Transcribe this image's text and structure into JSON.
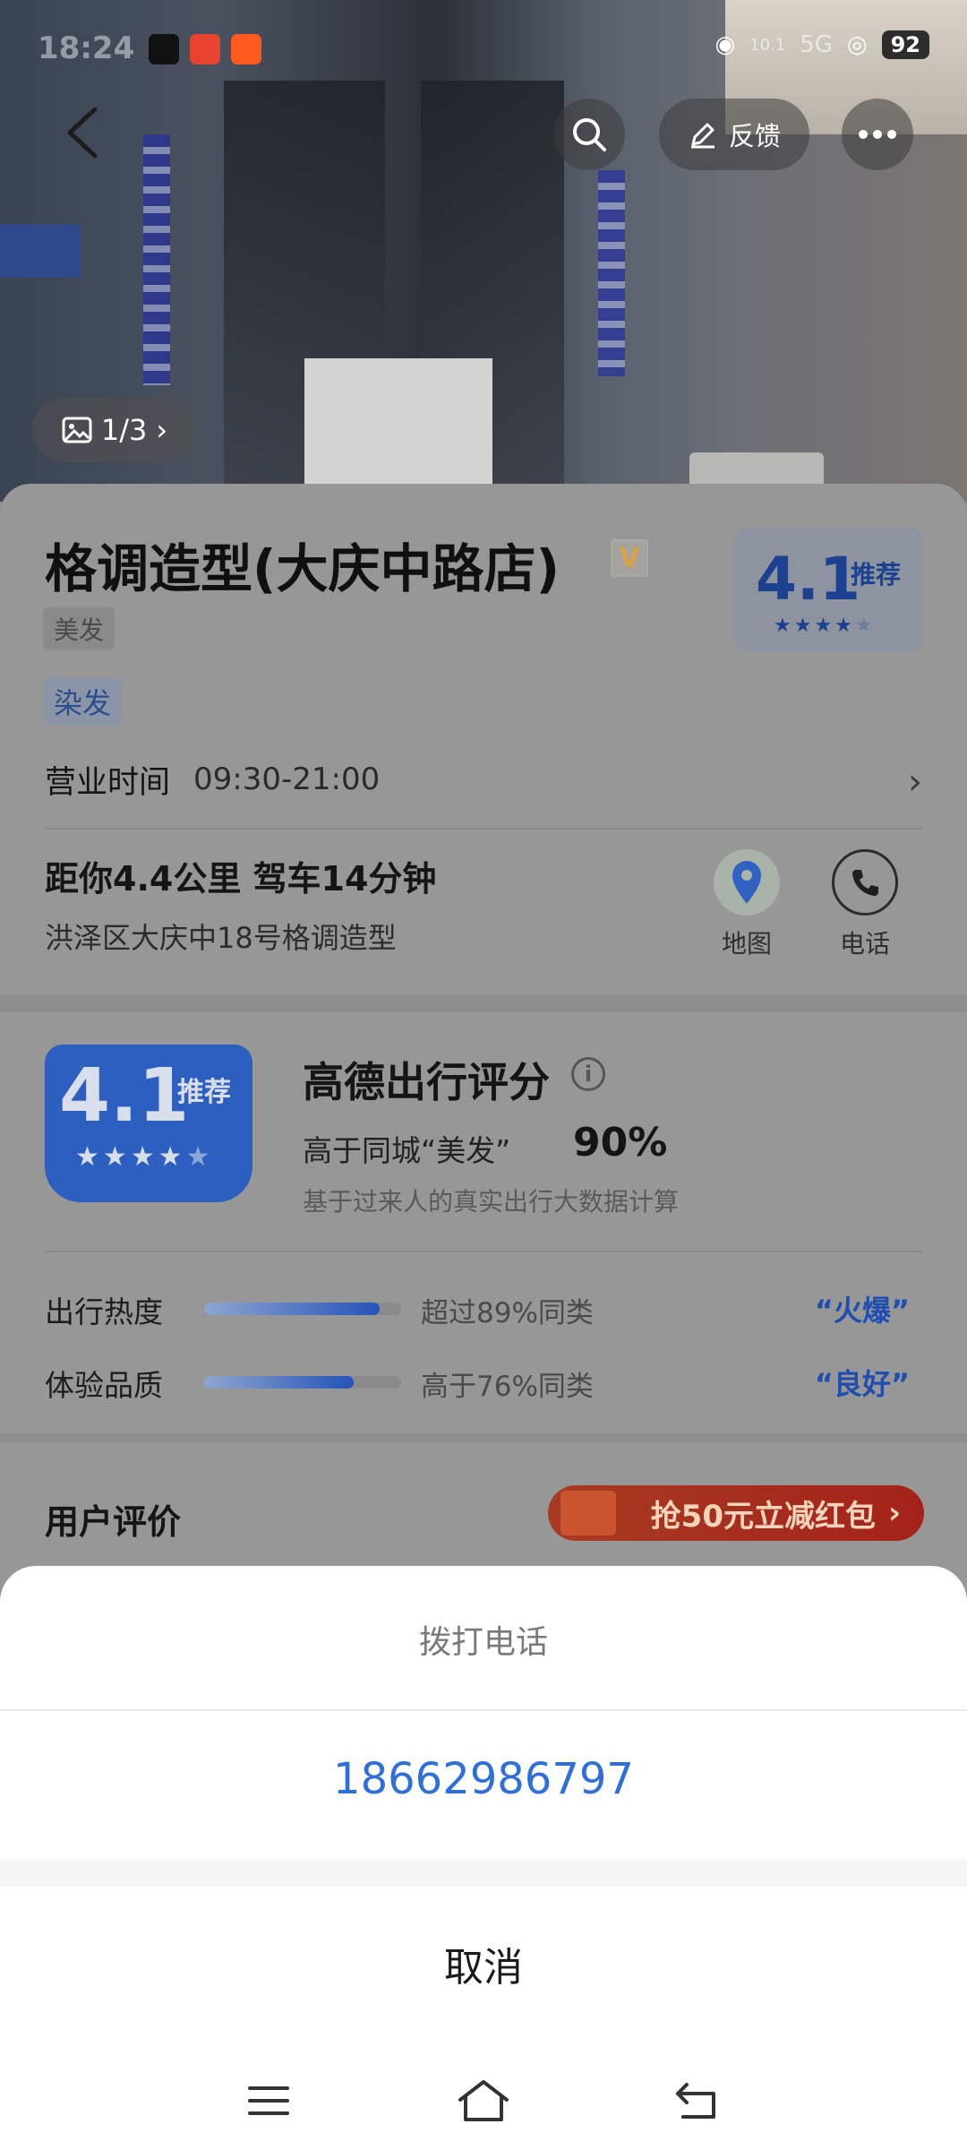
{
  "status_bar": {
    "time": "18:24",
    "battery": "92",
    "network": "5G",
    "speed": "10.1"
  },
  "header": {
    "feedback_label": "反馈",
    "photo_counter": "1/3"
  },
  "shop": {
    "name": "格调造型(大庆中路店)",
    "vip_badge": "V",
    "category": "美发",
    "service_tag": "染发",
    "score": "4.1",
    "score_label": "推荐",
    "hours_label": "营业时间",
    "hours_value": "09:30-21:00",
    "distance_text": "距你4.4公里  驾车14分钟",
    "address": "洪泽区大庆中18号格调造型",
    "map_label": "地图",
    "phone_label": "电话"
  },
  "rating": {
    "score": "4.1",
    "score_label": "推荐",
    "title": "高德出行评分",
    "compare_text": "高于同城“美发”",
    "compare_pct": "90%",
    "note": "基于过来人的真实出行大数据计算",
    "metrics": [
      {
        "label": "出行热度",
        "text": "超过89%同类",
        "level": "“火爆”",
        "fill": 0.89
      },
      {
        "label": "体验品质",
        "text": "高于76%同类",
        "level": "“良好”",
        "fill": 0.76
      }
    ]
  },
  "reviews": {
    "title": "用户评价",
    "coupon": "抢50元立减红包"
  },
  "sheet": {
    "title": "拨打电话",
    "phone_number": "18662986797",
    "cancel": "取消"
  },
  "colors": {
    "accent_blue": "#2f6fd9",
    "brand_blue": "#2c5fbf",
    "coupon_red": "#a5221a"
  }
}
